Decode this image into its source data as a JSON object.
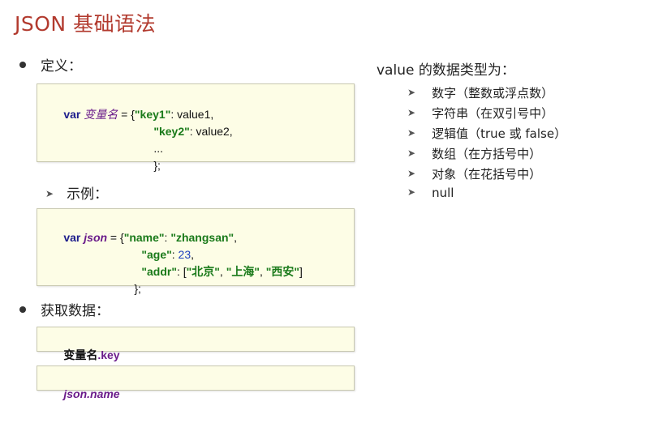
{
  "title": "JSON 基础语法",
  "definition": {
    "label": "定义：",
    "code": {
      "kw": "var",
      "varname": "变量名",
      "line1_eq": " = {",
      "key1": "\"key1\"",
      "val1": ": value1,",
      "key2": "\"key2\"",
      "val2": ": value2,",
      "ellipsis": "...",
      "close": "};"
    }
  },
  "example": {
    "label": "示例：",
    "code": {
      "kw": "var",
      "varname": "json",
      "eq": " = {",
      "k_name": "\"name\"",
      "colon1": ": ",
      "v_name": "\"zhangsan\"",
      "comma1": ",",
      "k_age": "\"age\"",
      "colon2": ": ",
      "v_age": "23",
      "comma2": ",",
      "k_addr": "\"addr\"",
      "colon3": ": [",
      "a1": "\"北京\"",
      "sep1": ", ",
      "a2": "\"上海\"",
      "sep2": ", ",
      "a3": "\"西安\"",
      "closebr": "]",
      "close": "};"
    }
  },
  "get_data": {
    "label": "获取数据：",
    "box1": {
      "part1": "变量名",
      "part2": ".key"
    },
    "box2": {
      "text": "json.name"
    }
  },
  "types": {
    "heading": "value 的数据类型为：",
    "items": [
      "数字（整数或浮点数）",
      "字符串（在双引号中）",
      "逻辑值（true 或 false）",
      "数组（在方括号中）",
      "对象（在花括号中）",
      "null"
    ]
  }
}
